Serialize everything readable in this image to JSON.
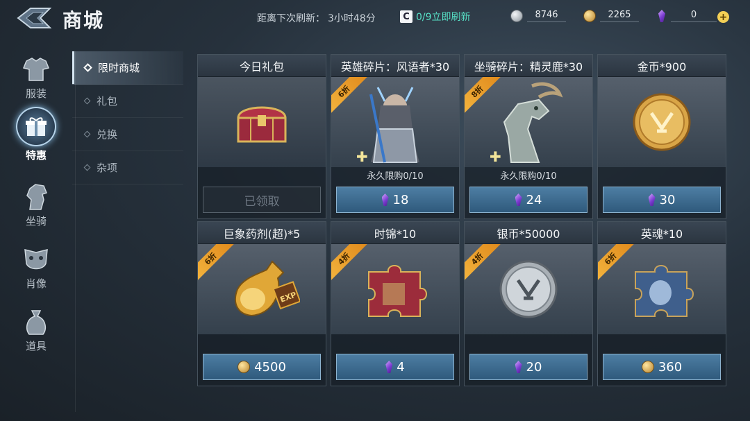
{
  "header": {
    "title": "商城",
    "refresh_label": "距离下次刷新：",
    "refresh_time": "3小时48分",
    "refresh_button": "0/9立即刷新",
    "refresh_icon_text": "C"
  },
  "currencies": [
    {
      "icon": "silver-coin-icon",
      "value": "8746"
    },
    {
      "icon": "gold-coin-icon",
      "value": "2265"
    },
    {
      "icon": "purple-gem-icon",
      "value": "0"
    }
  ],
  "nav": [
    {
      "label": "服装",
      "icon": "armor-icon"
    },
    {
      "label": "特惠",
      "icon": "gift-icon",
      "active": true
    },
    {
      "label": "坐骑",
      "icon": "horse-icon"
    },
    {
      "label": "肖像",
      "icon": "mask-icon"
    },
    {
      "label": "道具",
      "icon": "bag-icon"
    }
  ],
  "subnav": [
    {
      "label": "限时商城",
      "active": true
    },
    {
      "label": "礼包"
    },
    {
      "label": "兑换"
    },
    {
      "label": "杂项"
    }
  ],
  "cards": [
    {
      "title": "今日礼包",
      "art": "chest",
      "badge": "",
      "limit": "",
      "claimed": "已领取",
      "price": "",
      "currency": ""
    },
    {
      "title": "英雄碎片：风语者*30",
      "art": "hero",
      "badge": "6折",
      "limit": "永久限购0/10",
      "price": "18",
      "currency": "gem"
    },
    {
      "title": "坐骑碎片：精灵鹿*30",
      "art": "deer",
      "badge": "8折",
      "limit": "永久限购0/10",
      "price": "24",
      "currency": "gem"
    },
    {
      "title": "金币*900",
      "art": "goldcoin",
      "badge": "",
      "limit": "",
      "price": "30",
      "currency": "gem"
    },
    {
      "title": "巨象药剂(超)*5",
      "art": "potion",
      "badge": "6折",
      "limit": "",
      "price": "4500",
      "currency": "gold"
    },
    {
      "title": "时锦*10",
      "art": "puzzle-red",
      "badge": "4折",
      "limit": "",
      "price": "4",
      "currency": "gem"
    },
    {
      "title": "银币*50000",
      "art": "silvercoin",
      "badge": "4折",
      "limit": "",
      "price": "20",
      "currency": "gem"
    },
    {
      "title": "英魂*10",
      "art": "puzzle-blue",
      "badge": "6折",
      "limit": "",
      "price": "360",
      "currency": "gold"
    }
  ],
  "potion_label": "EXP",
  "colors": {
    "accent_teal": "#58e3c8",
    "badge_orange": "#f5b740",
    "button_blue": "#3f6d92"
  }
}
